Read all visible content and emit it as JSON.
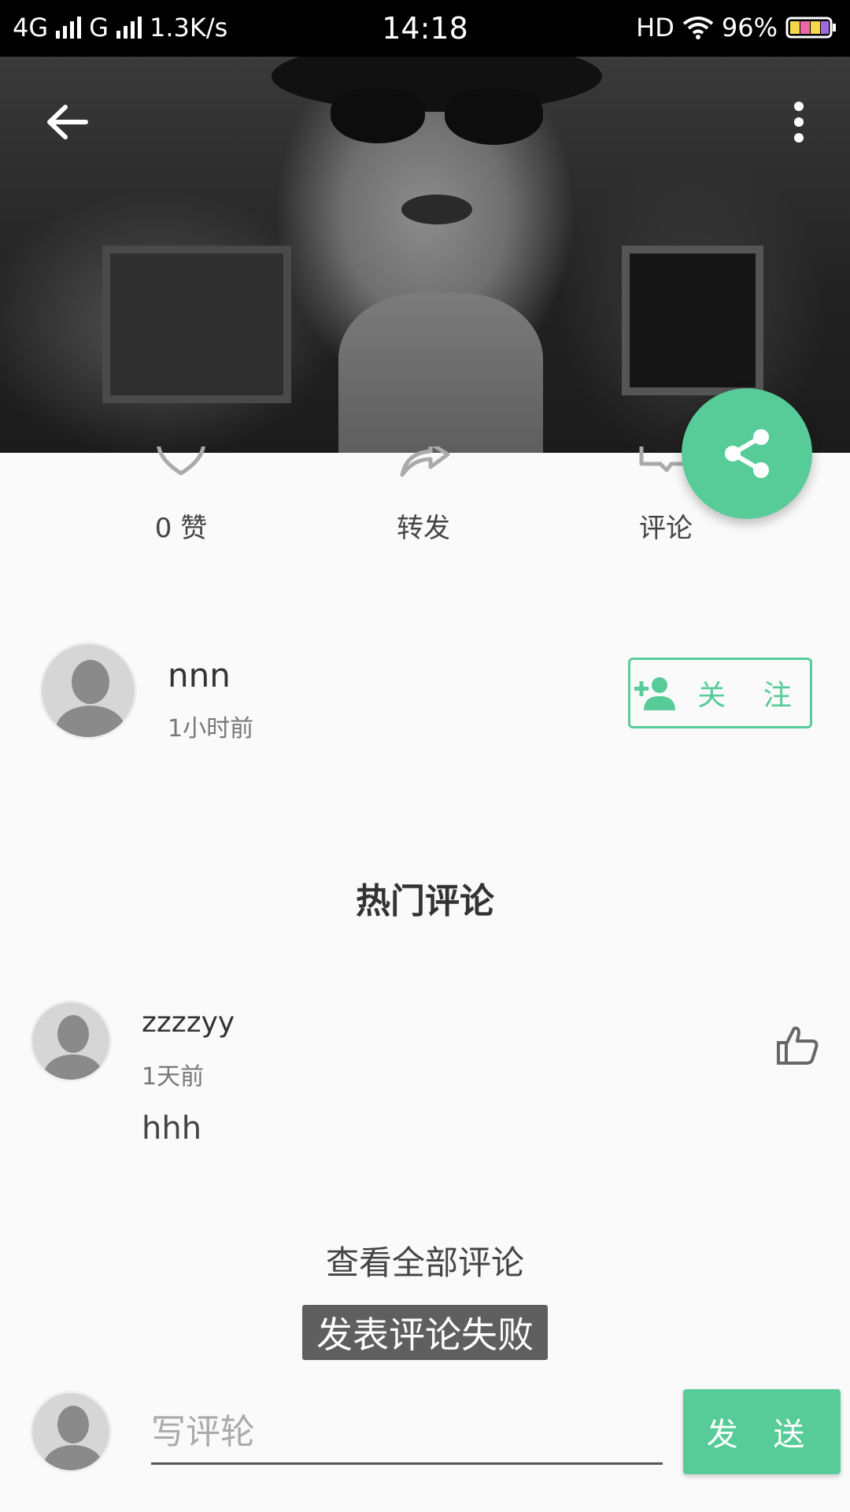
{
  "status_bar": {
    "network": "4G",
    "network2": "G",
    "speed": "1.3K/s",
    "time": "14:18",
    "hd": "HD",
    "battery": "96%"
  },
  "header": {
    "back_icon": "arrow-left-icon",
    "more_icon": "more-vert-icon"
  },
  "fab": {
    "icon": "share-icon",
    "color": "#57cc98"
  },
  "actions": {
    "like_label": "0 赞",
    "repost_label": "转发",
    "comment_label": "评论"
  },
  "author": {
    "name": "nnn",
    "time": "1小时前",
    "follow_label": "关 注",
    "follow_icon": "person-add-icon"
  },
  "hot_comments": {
    "title": "热门评论",
    "items": [
      {
        "name": "zzzzyy",
        "time": "1天前",
        "text": "hhh"
      }
    ],
    "view_all": "查看全部评论"
  },
  "toast": {
    "message": "发表评论失败"
  },
  "compose": {
    "placeholder": "写评轮",
    "send_label": "发 送"
  },
  "colors": {
    "accent": "#57cc98",
    "background": "#fafafa"
  }
}
